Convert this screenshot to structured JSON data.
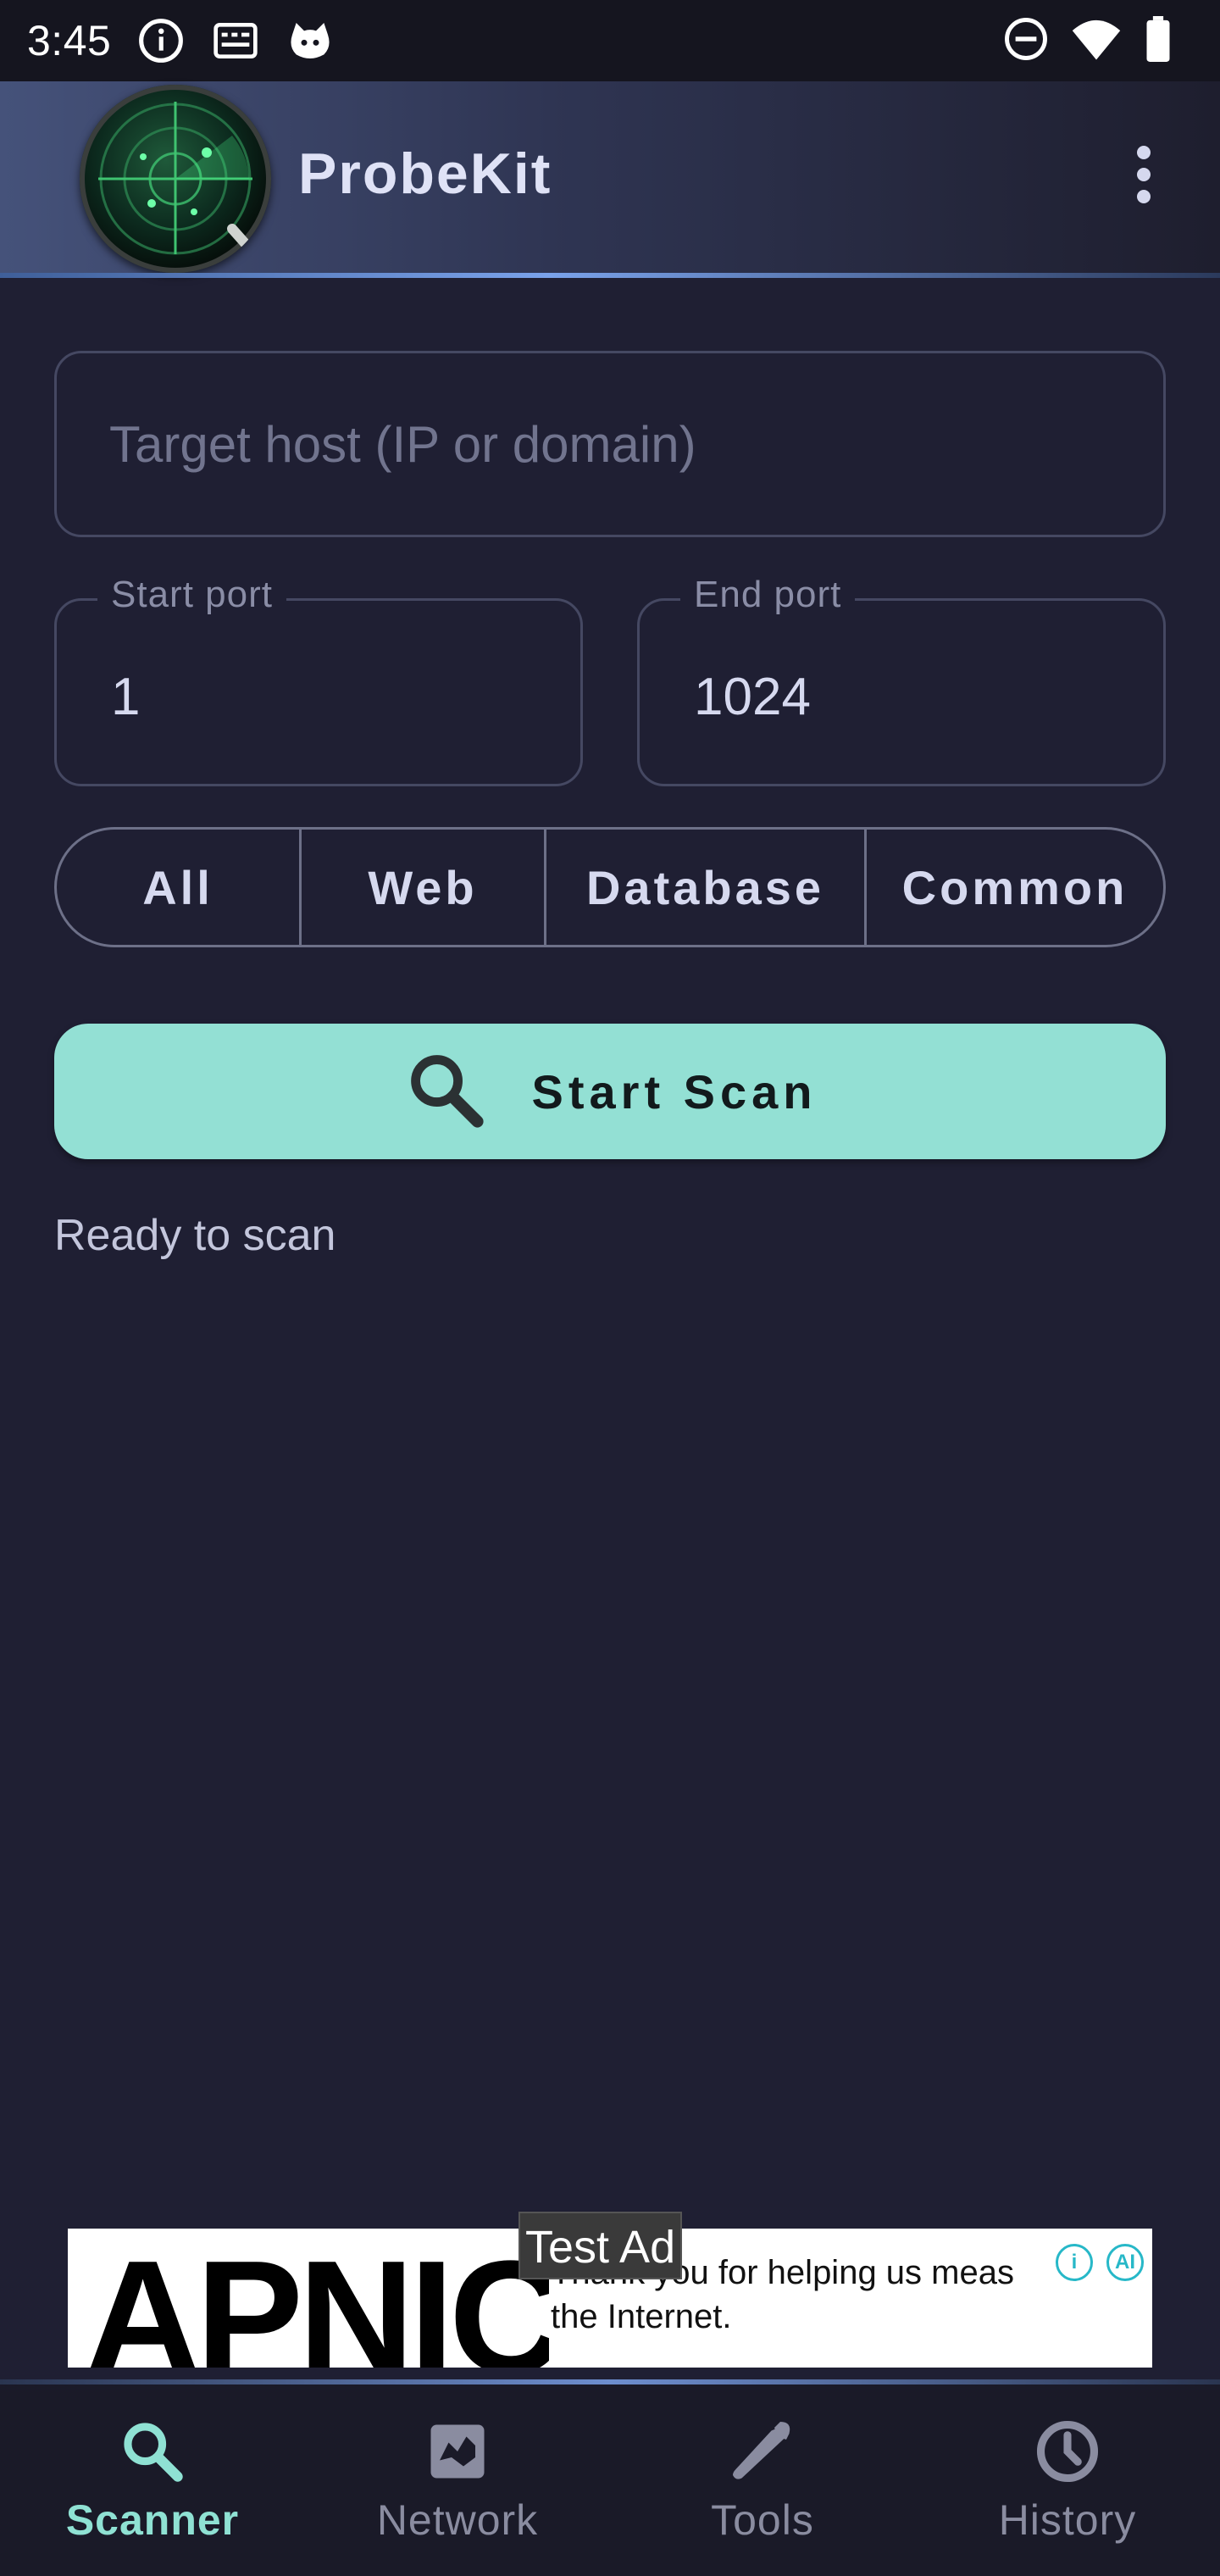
{
  "status_bar": {
    "time": "3:45",
    "left_icons": [
      "info-icon",
      "keyboard-icon",
      "cat-icon"
    ],
    "right_icons": [
      "do-not-disturb-icon",
      "wifi-icon",
      "battery-icon"
    ]
  },
  "app_bar": {
    "title": "ProbeKit",
    "logo_icon": "radar-magnifier-logo",
    "menu_icon": "more-vert-icon"
  },
  "scan_form": {
    "target_host": {
      "value": "",
      "placeholder": "Target host (IP or domain)"
    },
    "start_port": {
      "label": "Start port",
      "value": "1"
    },
    "end_port": {
      "label": "End port",
      "value": "1024"
    },
    "presets": [
      "All",
      "Web",
      "Database",
      "Common"
    ],
    "start_button": {
      "label": "Start Scan",
      "icon": "search-icon"
    },
    "status": "Ready to scan"
  },
  "ad": {
    "badge": "Test Ad",
    "brand": "APNIC",
    "text_line1": "Thank you for helping us meas",
    "text_line2": "the Internet.",
    "icons": [
      "ad-info-icon",
      "ad-choices-icon"
    ]
  },
  "bottom_nav": {
    "items": [
      {
        "label": "Scanner",
        "icon": "search-icon",
        "active": true
      },
      {
        "label": "Network",
        "icon": "map-icon",
        "active": false
      },
      {
        "label": "Tools",
        "icon": "wrench-icon",
        "active": false
      },
      {
        "label": "History",
        "icon": "clock-icon",
        "active": false
      }
    ]
  },
  "colors": {
    "background": "#1f1f33",
    "accent": "#93e0d4",
    "nav_active": "#8fe1d3",
    "status_bar": "#15151f"
  }
}
